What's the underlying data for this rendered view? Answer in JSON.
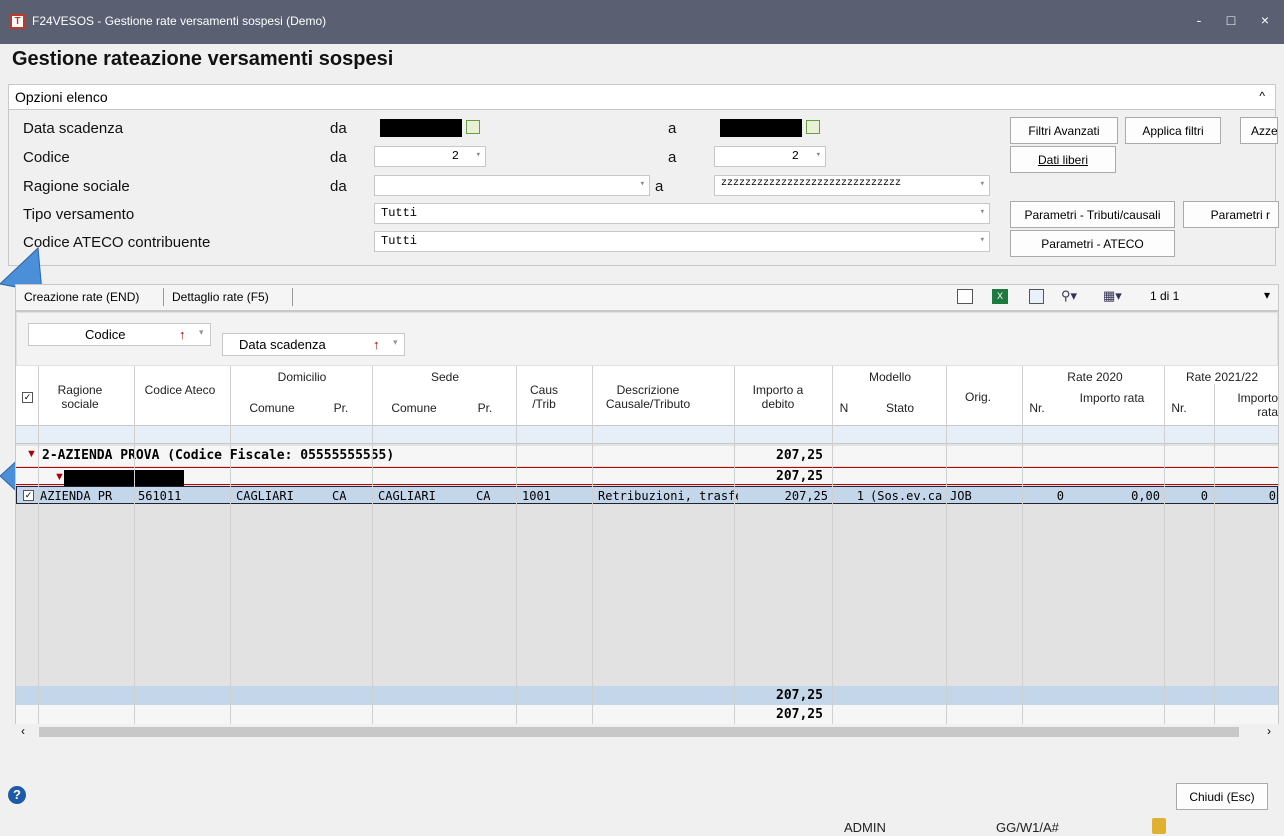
{
  "window": {
    "title": "F24VESOS - Gestione rate versamenti sospesi  (Demo)",
    "app_icon": "T",
    "minimize": "-",
    "maximize": "□",
    "close": "×"
  },
  "page_title": "Gestione rateazione versamenti sospesi",
  "options": {
    "header": "Opzioni elenco",
    "collapse_icon": "^",
    "rows": [
      {
        "label": "Data scadenza",
        "from_label": "da",
        "to_label": "a"
      },
      {
        "label": "Codice",
        "from_label": "da",
        "to_label": "a",
        "from_value": "2",
        "to_value": "2"
      },
      {
        "label": "Ragione sociale",
        "from_label": "da",
        "to_label": "a",
        "from_value": "",
        "to_value": "zzzzzzzzzzzzzzzzzzzzzzzzzzzzzz"
      },
      {
        "label": "Tipo versamento",
        "value": "Tutti"
      },
      {
        "label": "Codice ATECO contribuente",
        "value": "Tutti"
      }
    ],
    "buttons": {
      "filtri_avanzati": "Filtri Avanzati",
      "applica_filtri": "Applica filtri",
      "azzera": "Azze",
      "dati_liberi": "Dati liberi",
      "parametri_tributi": "Parametri - Tributi/causali",
      "parametri_r": "Parametri r",
      "parametri_ateco": "Parametri - ATECO"
    }
  },
  "toolbar": {
    "tab1": "Creazione rate (END)",
    "tab2": "Dettaglio rate (F5)",
    "page_info": "1 di 1",
    "more": "▾"
  },
  "group_chips": {
    "codice": "Codice",
    "data_scadenza": "Data scadenza",
    "sort_icon": "↑"
  },
  "columns": {
    "ragione_sociale": "Ragione sociale",
    "codice_ateco": "Codice Ateco",
    "domicilio": "Domicilio",
    "sede": "Sede",
    "comune": "Comune",
    "pr": "Pr.",
    "caus_trib": "Caus /Trib",
    "descrizione": "Descrizione Causale/Tributo",
    "importo_debito": "Importo a debito",
    "modello": "Modello",
    "n": "N",
    "stato": "Stato",
    "orig": "Orig.",
    "rate2020": "Rate 2020",
    "rate2021": "Rate 2021/22",
    "nr": "Nr.",
    "importo_rata": "Importo rata"
  },
  "group_row": {
    "label": "2-AZIENDA PROVA (Codice Fiscale: 05555555555)",
    "total": "207,25"
  },
  "subgroup_row": {
    "total": "207,25"
  },
  "data_row": {
    "ragione": "AZIENDA PR",
    "ateco": "561011",
    "dom_comune": "CAGLIARI",
    "dom_pr": "CA",
    "sede_comune": "CAGLIARI",
    "sede_pr": "CA",
    "caus": "1001",
    "descrizione": "Retribuzioni, trasfer",
    "importo": "207,25",
    "n": "1",
    "stato": "(Sos.ev.ca",
    "orig": "JOB",
    "nr2020": "0",
    "imp2020": "0,00",
    "nr2021": "0",
    "imp2021": "0"
  },
  "footer_totals": [
    "207,25",
    "207,25"
  ],
  "bottom": {
    "close": "Chiudi (Esc)",
    "user": "ADMIN",
    "company": "GG/W1/A#",
    "help": "?"
  }
}
